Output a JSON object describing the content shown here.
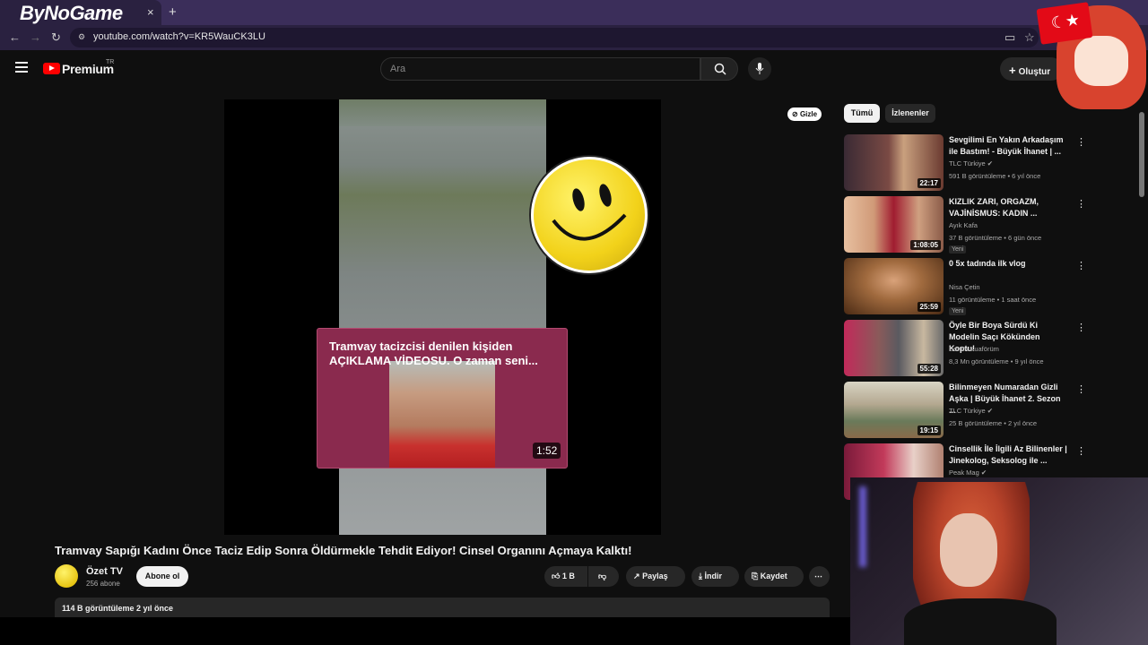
{
  "browser": {
    "overlay_logo": "ByNoGame",
    "tab_close": "×",
    "new_tab": "+",
    "url": "youtube.com/watch?v=KR5WauCK3LU"
  },
  "header": {
    "brand": "Premium",
    "region": "TR",
    "search_placeholder": "Ara",
    "create_label": "Oluştur"
  },
  "player": {
    "hide_label": "Gizle",
    "endcard_title": "Tramvay tacizcisi denilen kişiden AÇIKLAMA VİDEOSU. O zaman seni...",
    "endcard_duration": "1:52"
  },
  "video": {
    "title": "Tramvay Sapığı Kadını Önce Taciz Edip Sonra Öldürmekle Tehdit Ediyor! Cinsel Organını Açmaya Kalktı!",
    "channel": "Özet TV",
    "subscribers": "256 abone",
    "subscribe": "Abone ol",
    "likes": "1 B",
    "share": "Paylaş",
    "download": "İndir",
    "save": "Kaydet",
    "meta": "114 B görüntüleme  2 yıl önce"
  },
  "sidebar": {
    "chips": [
      "Tümü",
      "İzlenenler"
    ],
    "items": [
      {
        "title": "Sevgilimi En Yakın Arkadaşım ile Bastım! - Büyük İhanet | ...",
        "channel": "TLC Türkiye ✔",
        "views": "591 B görüntüleme • 6 yıl önce",
        "duration": "22:17",
        "badge": ""
      },
      {
        "title": "KIZLIK ZARI, ORGAZM, VAJİNİSMUS: KADIN ...",
        "channel": "Ayık Kafa",
        "views": "37 B görüntüleme • 6 gün önce",
        "duration": "1:08:05",
        "badge": "Yeni"
      },
      {
        "title": "0 5x tadında ilk vlog",
        "channel": "Nisa Çetin",
        "views": "11 görüntüleme • 1 saat önce",
        "duration": "25:59",
        "badge": "Yeni"
      },
      {
        "title": "Öyle Bir Boya Sürdü Ki Modelin Saçı Kökünden Koptu!",
        "channel": "Benim Kuaförüm",
        "views": "8,3 Mn görüntüleme • 9 yıl önce",
        "duration": "55:28",
        "badge": ""
      },
      {
        "title": "Bilinmeyen Numaradan Gizli Aşka | Büyük İhanet 2. Sezon ...",
        "channel": "TLC Türkiye ✔",
        "views": "25 B görüntüleme • 2 yıl önce",
        "duration": "19:15",
        "badge": ""
      },
      {
        "title": "Cinsellik İle İlgili Az Bilinenler | Jinekolog, Seksolog ile ...",
        "channel": "Peak Mag ✔",
        "views": "",
        "duration": "",
        "badge": ""
      }
    ]
  },
  "colors": {
    "background": "#0f0f0f",
    "brand_red": "#ff0000",
    "endcard": "#8a2a4e"
  }
}
